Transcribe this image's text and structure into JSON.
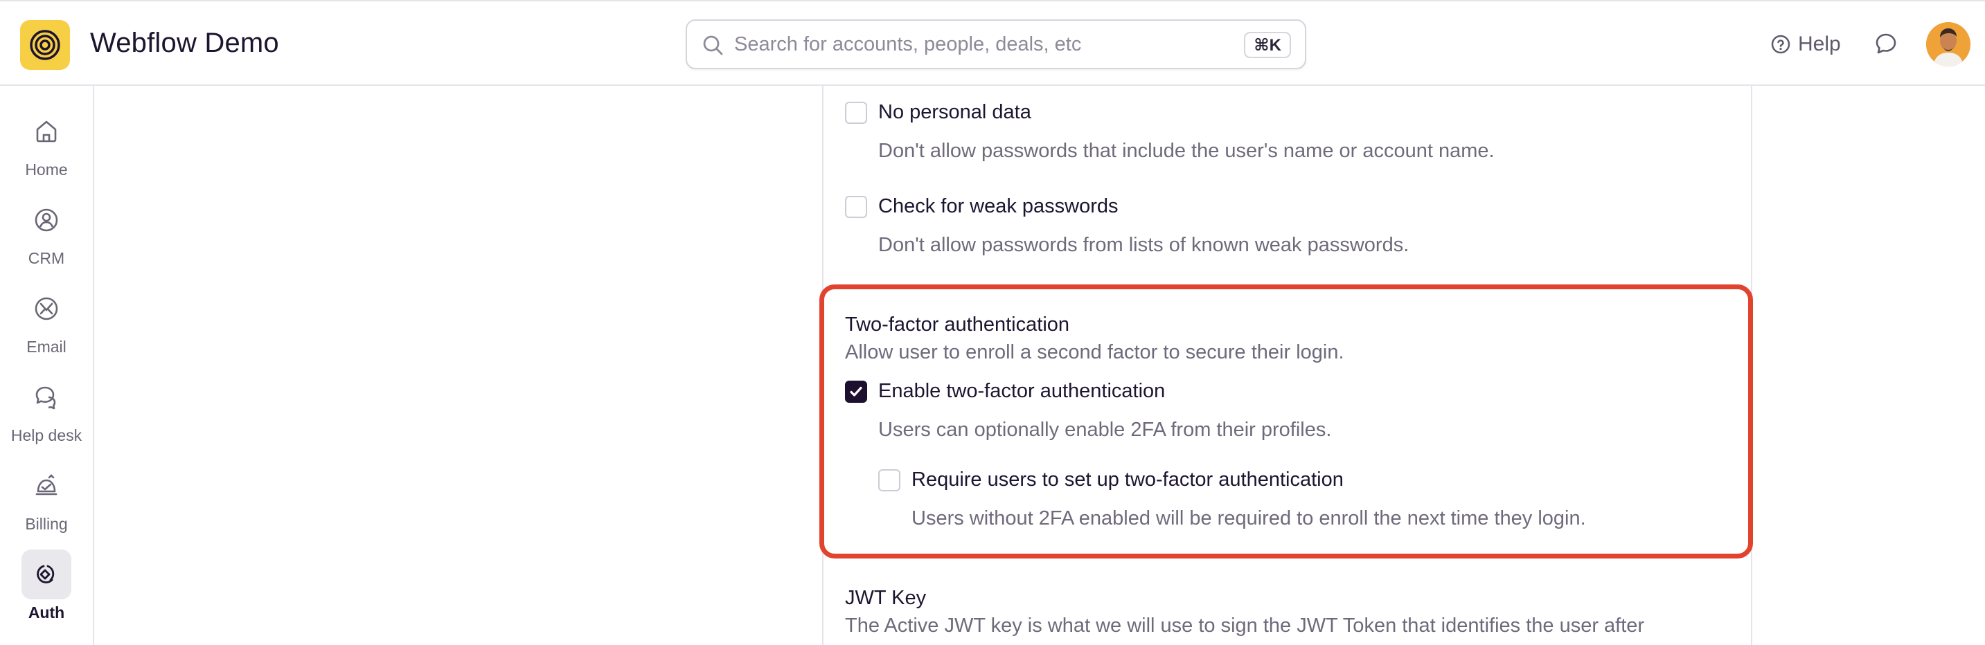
{
  "app": {
    "title": "Webflow Demo"
  },
  "search": {
    "placeholder": "Search for accounts, people, deals, etc",
    "value": "",
    "shortcut": "⌘K"
  },
  "header": {
    "help_label": "Help"
  },
  "sidebar": {
    "items": [
      {
        "label": "Home",
        "icon": "home-icon"
      },
      {
        "label": "CRM",
        "icon": "crm-icon"
      },
      {
        "label": "Email",
        "icon": "email-icon"
      },
      {
        "label": "Help desk",
        "icon": "help-desk-icon"
      },
      {
        "label": "Billing",
        "icon": "billing-icon"
      },
      {
        "label": "Auth",
        "icon": "auth-icon",
        "active": true
      }
    ]
  },
  "settings": {
    "no_personal_data": {
      "label": "No personal data",
      "description": "Don't allow passwords that include the user's name or account name.",
      "checked": false
    },
    "weak_passwords": {
      "label": "Check for weak passwords",
      "description": "Don't allow passwords from lists of known weak passwords.",
      "checked": false
    },
    "two_factor": {
      "title": "Two-factor authentication",
      "subtitle": "Allow user to enroll a second factor to secure their login.",
      "enable": {
        "label": "Enable two-factor authentication",
        "description": "Users can optionally enable 2FA from their profiles.",
        "checked": true
      },
      "require": {
        "label": "Require users to set up two-factor authentication",
        "description": "Users without 2FA enabled will be required to enroll the next time they login.",
        "checked": false
      }
    },
    "jwt": {
      "title": "JWT Key",
      "description": "The Active JWT key is what we will use to sign the JWT Token that identifies the user after"
    }
  },
  "colors": {
    "highlight": "#e2432e",
    "brand": "#f7cf45",
    "checkbox_checked": "#1d0f2e"
  }
}
